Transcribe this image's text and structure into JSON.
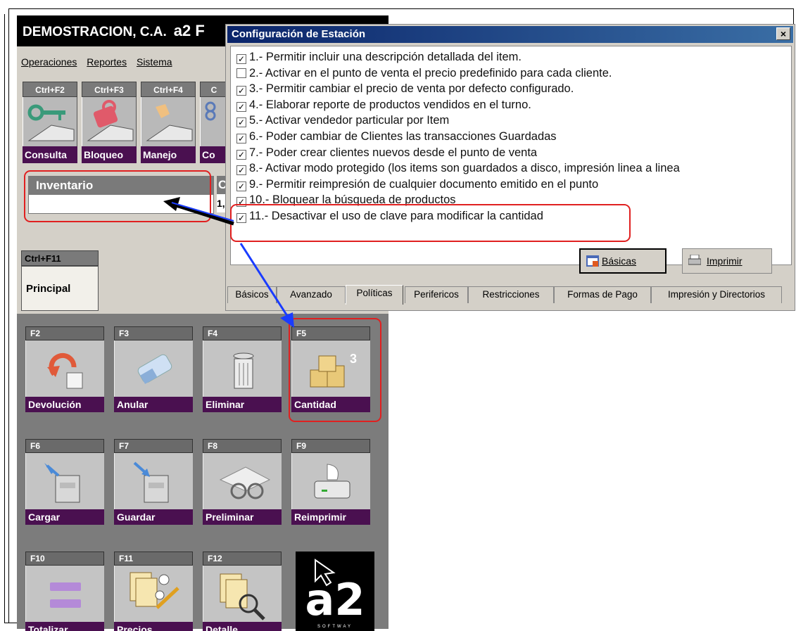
{
  "app": {
    "company": "DEMOSTRACION, C.A.",
    "brand": "a2 F",
    "menu": [
      "Operaciones",
      "Reportes",
      "Sistema"
    ],
    "top_buttons": [
      {
        "key": "Ctrl+F2",
        "label": "Consulta",
        "icon": "key-icon"
      },
      {
        "key": "Ctrl+F3",
        "label": "Bloqueo",
        "icon": "padlock-icon"
      },
      {
        "key": "Ctrl+F4",
        "label": "Manejo",
        "icon": "hand-icon"
      },
      {
        "key": "C",
        "label": "Co",
        "icon": "chain-icon"
      }
    ],
    "inventario": {
      "header": "Inventario",
      "value": "",
      "next_header": "C",
      "next_value": "1,"
    },
    "tab": {
      "key": "Ctrl+F11",
      "label": "Principal"
    },
    "fkeys": [
      {
        "key": "F2",
        "label": "Devolución",
        "icon": "return-icon"
      },
      {
        "key": "F3",
        "label": "Anular",
        "icon": "eraser-icon"
      },
      {
        "key": "F4",
        "label": "Eliminar",
        "icon": "trash-icon"
      },
      {
        "key": "F5",
        "label": "Cantidad",
        "icon": "boxes-icon"
      },
      {
        "key": "F6",
        "label": "Cargar",
        "icon": "cabinet-load-icon"
      },
      {
        "key": "F7",
        "label": "Guardar",
        "icon": "cabinet-save-icon"
      },
      {
        "key": "F8",
        "label": "Preliminar",
        "icon": "glasses-icon"
      },
      {
        "key": "F9",
        "label": "Reimprimir",
        "icon": "printer-icon"
      },
      {
        "key": "F10",
        "label": "Totalizar",
        "icon": "equals-icon"
      },
      {
        "key": "F11",
        "label": "Precios",
        "icon": "price-list-icon"
      },
      {
        "key": "F12",
        "label": "Detalle",
        "icon": "magnifier-doc-icon"
      }
    ],
    "logo": {
      "big": "a2",
      "small": "SOFTWAY"
    }
  },
  "dialog": {
    "title": "Configuración de Estación",
    "close": "×",
    "options": [
      {
        "text": "1.- Permitir incluir una descripción detallada del item.",
        "checked": true
      },
      {
        "text": "2.- Activar en  el punto de venta el precio predefinido para cada cliente.",
        "checked": false
      },
      {
        "text": "3.- Permitir cambiar el precio de venta por defecto configurado.",
        "checked": true
      },
      {
        "text": "4.- Elaborar reporte de productos vendidos en el turno.",
        "checked": true
      },
      {
        "text": "5.- Activar vendedor particular por Item",
        "checked": true
      },
      {
        "text": "6.- Poder cambiar de Clientes las transacciones Guardadas",
        "checked": true
      },
      {
        "text": "7.- Poder crear clientes nuevos desde el punto de venta",
        "checked": true
      },
      {
        "text": "8.- Activar modo protegido (los items son guardados a disco, impresión linea a linea",
        "checked": true
      },
      {
        "text": "9.- Permitir reimpresión de cualquier documento emitido en el punto",
        "checked": true
      },
      {
        "text": "10.- Bloquear la búsqueda de productos",
        "checked": true
      },
      {
        "text": "11.- Desactivar el uso de clave para modificar la cantidad",
        "checked": true
      }
    ],
    "buttons": {
      "basicas": "Básicas",
      "imprimir": "Imprimir"
    },
    "tabs": [
      "Básicos",
      "Avanzado",
      "Políticas",
      "Perifericos",
      "Restricciones",
      "Formas de Pago",
      "Impresión y Directorios"
    ],
    "active_tab": "Políticas"
  },
  "annotation_colors": {
    "highlight": "#e02020",
    "arrow_blue": "#1a3cff",
    "arrow_black": "#000000"
  }
}
